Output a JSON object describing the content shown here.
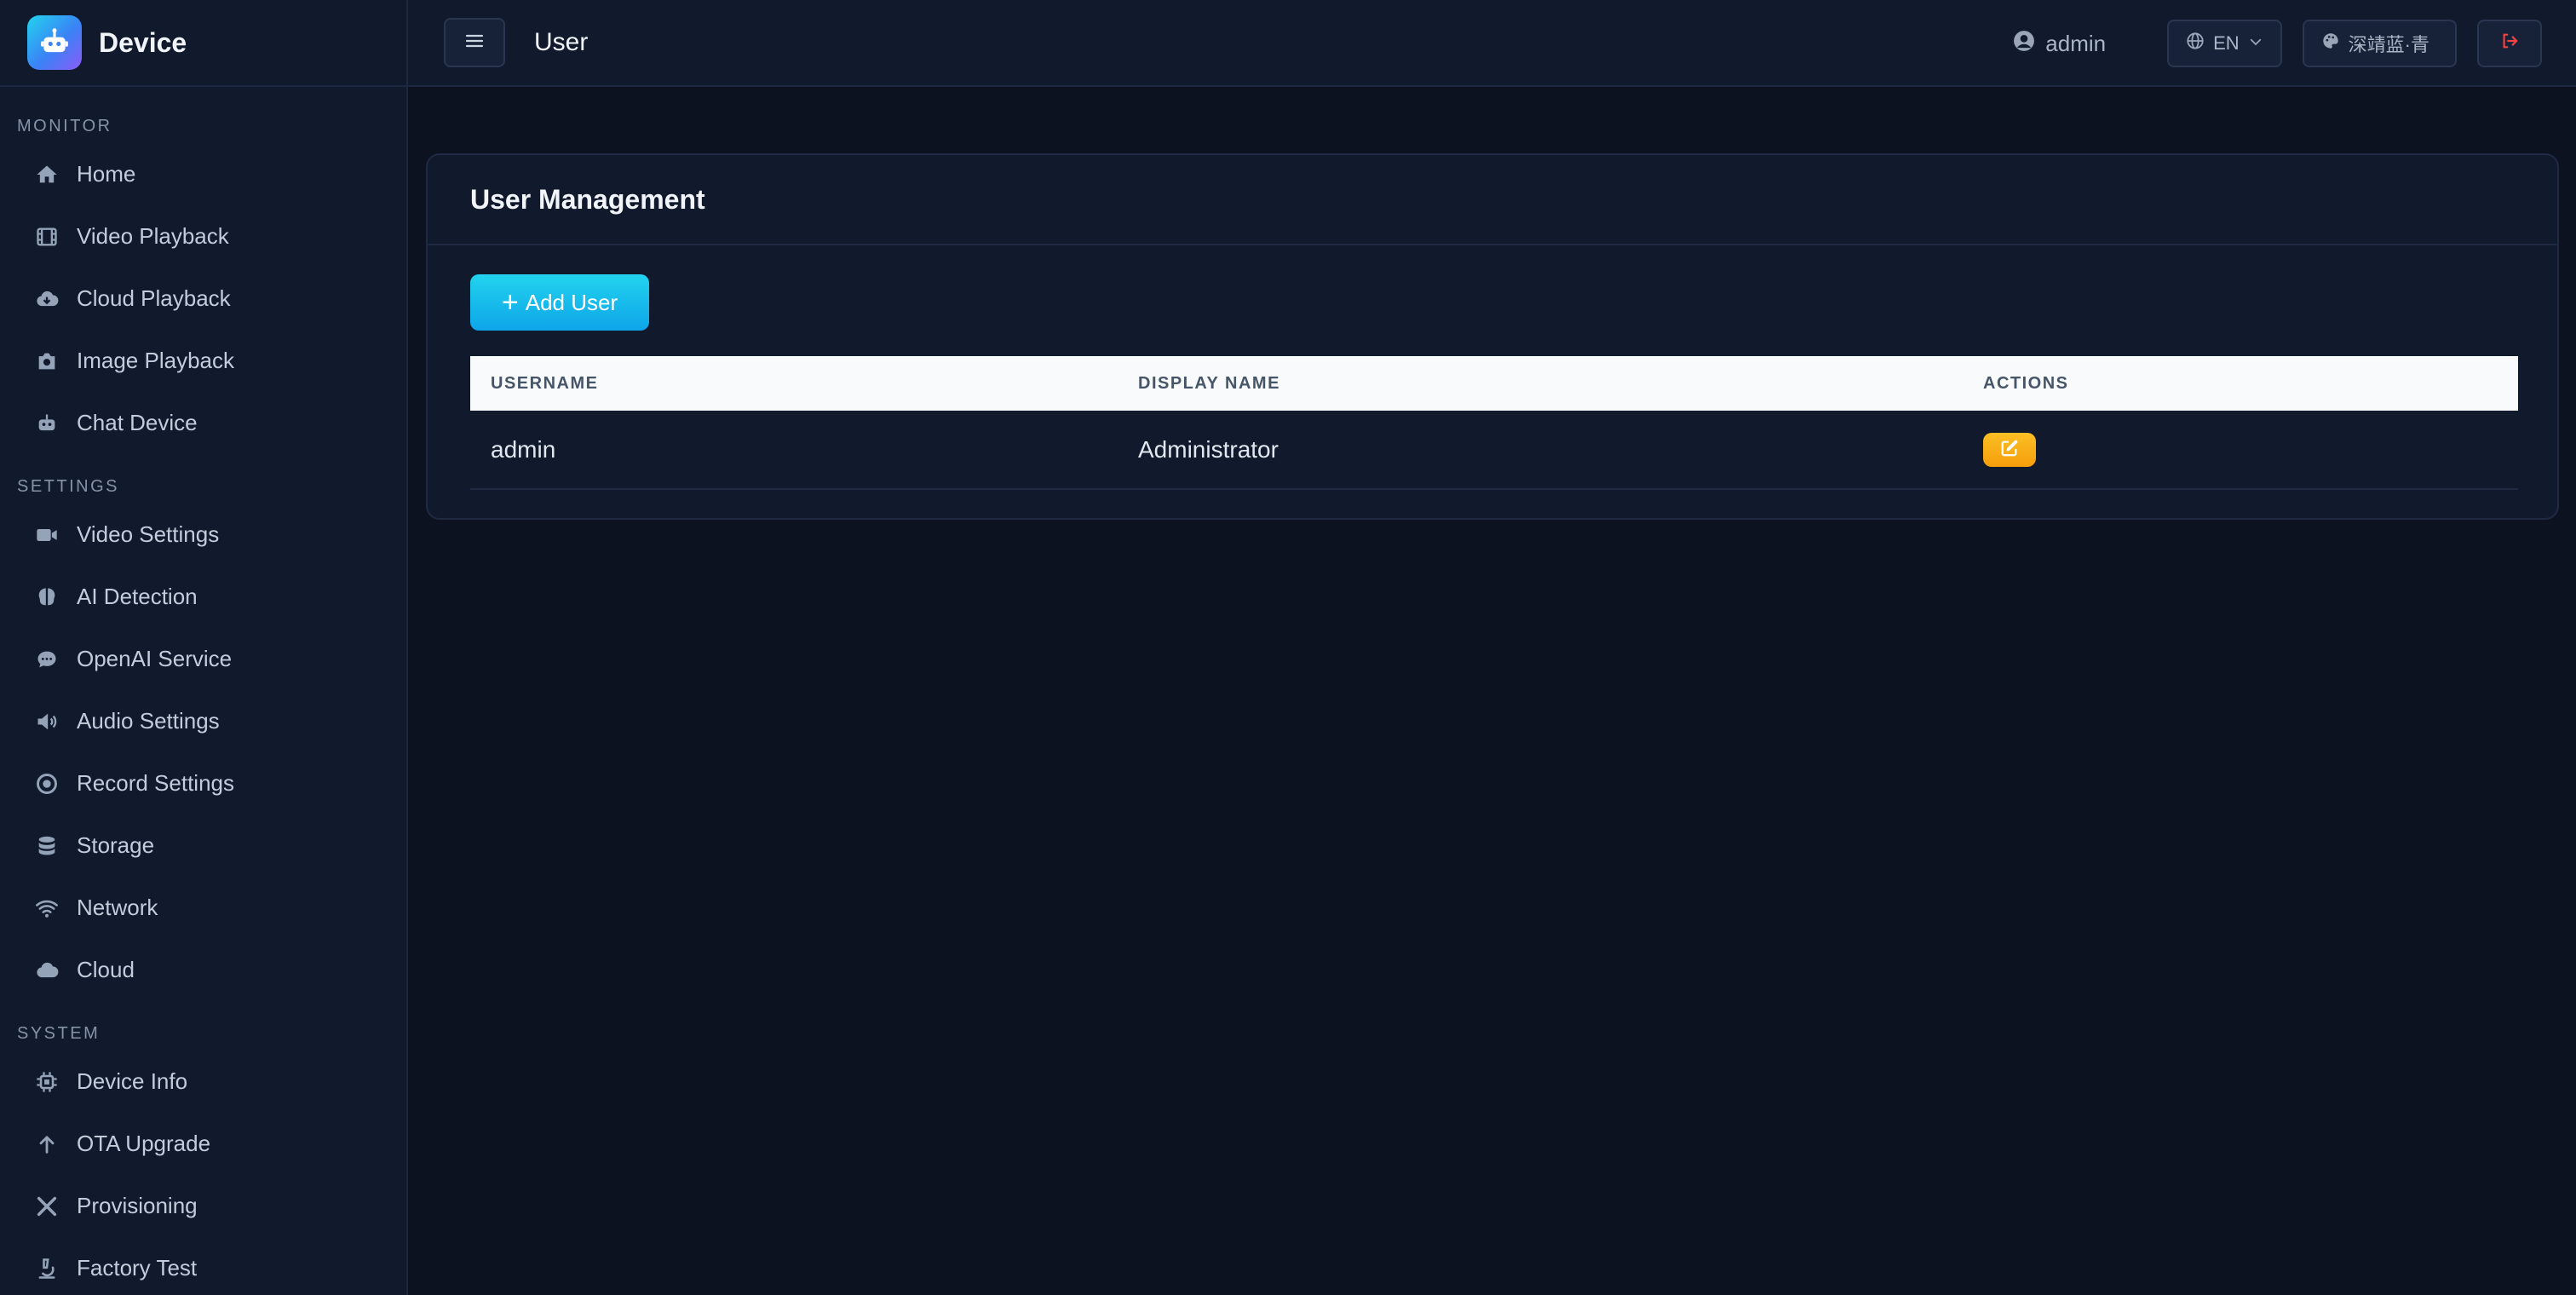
{
  "brand": {
    "title": "Device",
    "logo_icon": "robot-icon"
  },
  "sidebar": {
    "sections": [
      {
        "label": "MONITOR",
        "items": [
          {
            "label": "Home",
            "icon": "home-icon"
          },
          {
            "label": "Video Playback",
            "icon": "film-icon"
          },
          {
            "label": "Cloud Playback",
            "icon": "cloud-download-icon"
          },
          {
            "label": "Image Playback",
            "icon": "camera-icon"
          },
          {
            "label": "Chat Device",
            "icon": "robot-icon"
          }
        ]
      },
      {
        "label": "SETTINGS",
        "items": [
          {
            "label": "Video Settings",
            "icon": "video-icon"
          },
          {
            "label": "AI Detection",
            "icon": "brain-icon"
          },
          {
            "label": "OpenAI Service",
            "icon": "chat-icon"
          },
          {
            "label": "Audio Settings",
            "icon": "speaker-icon"
          },
          {
            "label": "Record Settings",
            "icon": "record-icon"
          },
          {
            "label": "Storage",
            "icon": "database-icon"
          },
          {
            "label": "Network",
            "icon": "wifi-icon"
          },
          {
            "label": "Cloud",
            "icon": "cloud-icon"
          }
        ]
      },
      {
        "label": "SYSTEM",
        "items": [
          {
            "label": "Device Info",
            "icon": "chip-icon"
          },
          {
            "label": "OTA Upgrade",
            "icon": "arrow-up-icon"
          },
          {
            "label": "Provisioning",
            "icon": "tools-icon"
          },
          {
            "label": "Factory Test",
            "icon": "microscope-icon"
          }
        ]
      }
    ]
  },
  "header": {
    "title": "User",
    "user": "admin",
    "language": "EN",
    "theme": "深靖蓝·青"
  },
  "card": {
    "title": "User Management",
    "add_button": "Add User",
    "columns": [
      "USERNAME",
      "DISPLAY NAME",
      "ACTIONS"
    ],
    "rows": [
      {
        "username": "admin",
        "display_name": "Administrator"
      }
    ]
  },
  "colors": {
    "accent": "#22d3ee",
    "edit": "#f59e0b",
    "logout": "#ef4444",
    "background": "#0c1220"
  }
}
